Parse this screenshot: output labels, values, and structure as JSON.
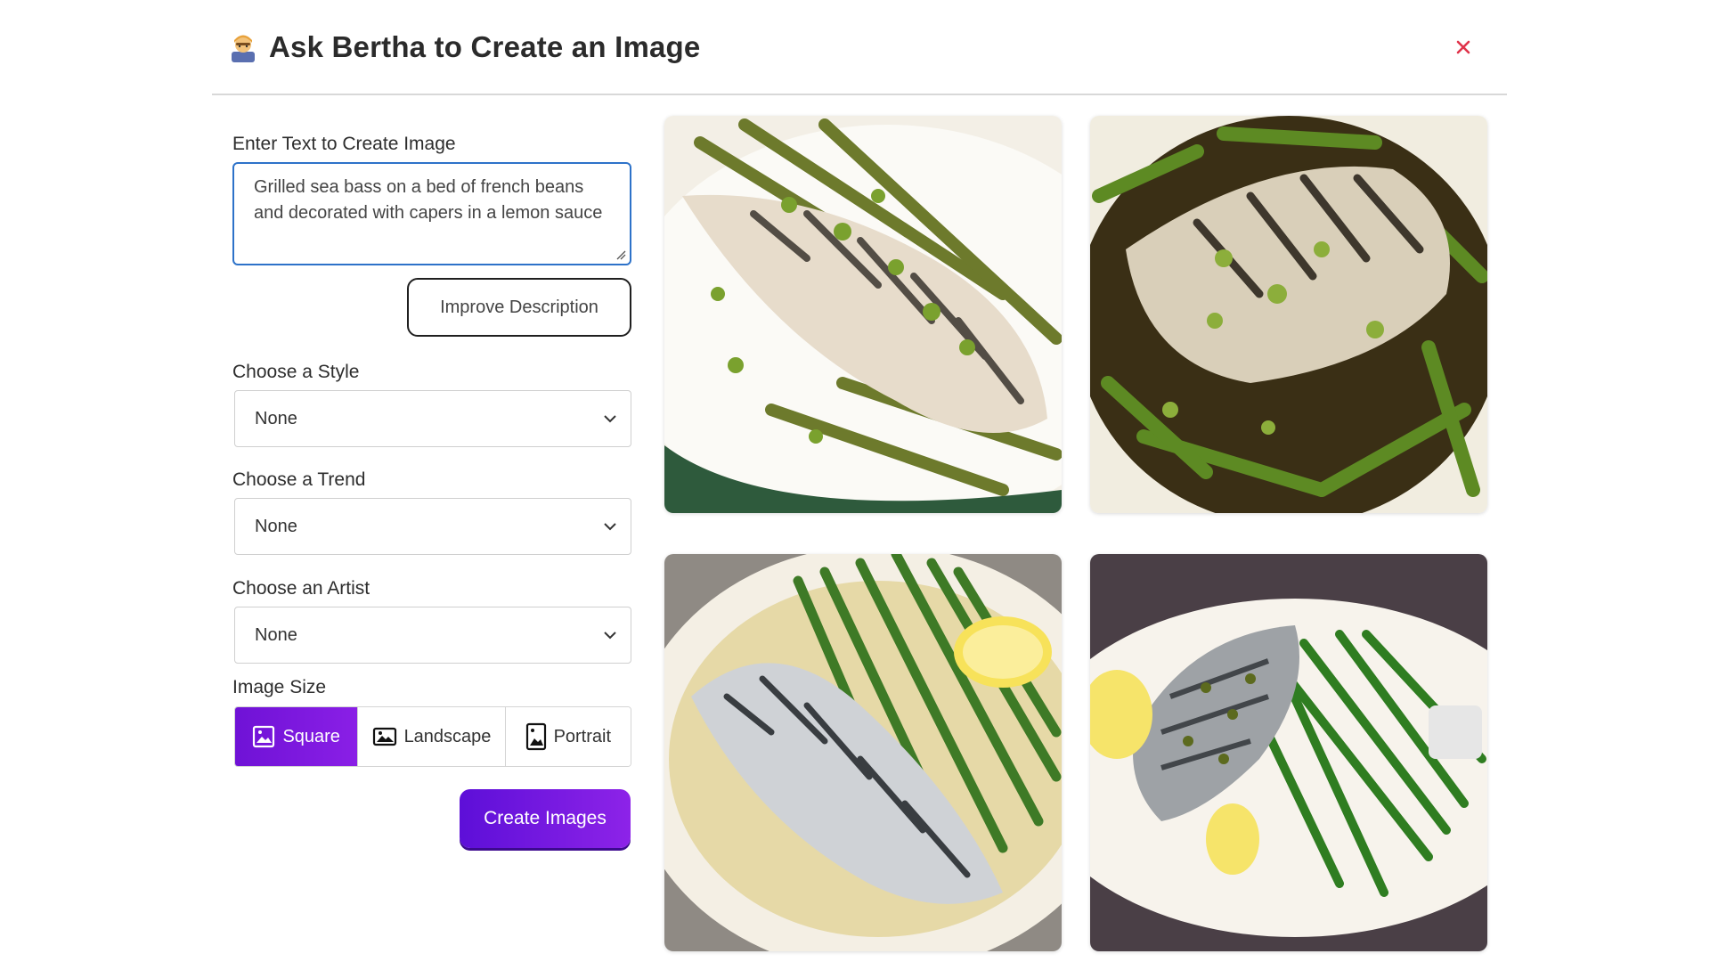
{
  "dialog": {
    "title": "Ask Bertha to Create an Image",
    "close_label": "×"
  },
  "form": {
    "prompt_label": "Enter Text to Create Image",
    "prompt_value": "Grilled sea bass on a bed of french beans and decorated with capers in a lemon sauce",
    "improve_label": "Improve Description",
    "style": {
      "label": "Choose a Style",
      "value": "None"
    },
    "trend": {
      "label": "Choose a Trend",
      "value": "None"
    },
    "artist": {
      "label": "Choose an Artist",
      "value": "None"
    },
    "size": {
      "label": "Image Size",
      "options": [
        "Square",
        "Landscape",
        "Portrait"
      ],
      "selected": "Square"
    },
    "create_label": "Create Images"
  },
  "colors": {
    "accent": "#6f12d6",
    "focus_border": "#2d72c9",
    "close": "#e0334a"
  },
  "results": [
    {
      "name": "generated-image-1",
      "icon": "food-photo"
    },
    {
      "name": "generated-image-2",
      "icon": "food-photo"
    },
    {
      "name": "generated-image-3",
      "icon": "food-photo"
    },
    {
      "name": "generated-image-4",
      "icon": "food-photo"
    }
  ]
}
